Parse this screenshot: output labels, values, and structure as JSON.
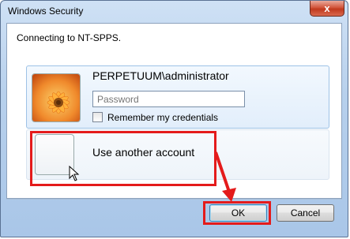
{
  "window": {
    "title": "Windows Security",
    "close_label": "x"
  },
  "dialog": {
    "message": "Connecting to NT-SPPS."
  },
  "credential_tile": {
    "username": "PERPETUUM\\administrator",
    "password_placeholder": "Password",
    "password_value": "",
    "remember_label": "Remember my credentials",
    "remember_checked": false
  },
  "other_account_tile": {
    "label": "Use another account"
  },
  "buttons": {
    "ok": "OK",
    "cancel": "Cancel"
  },
  "annotations": {
    "highlight_color": "#e41b1b"
  }
}
